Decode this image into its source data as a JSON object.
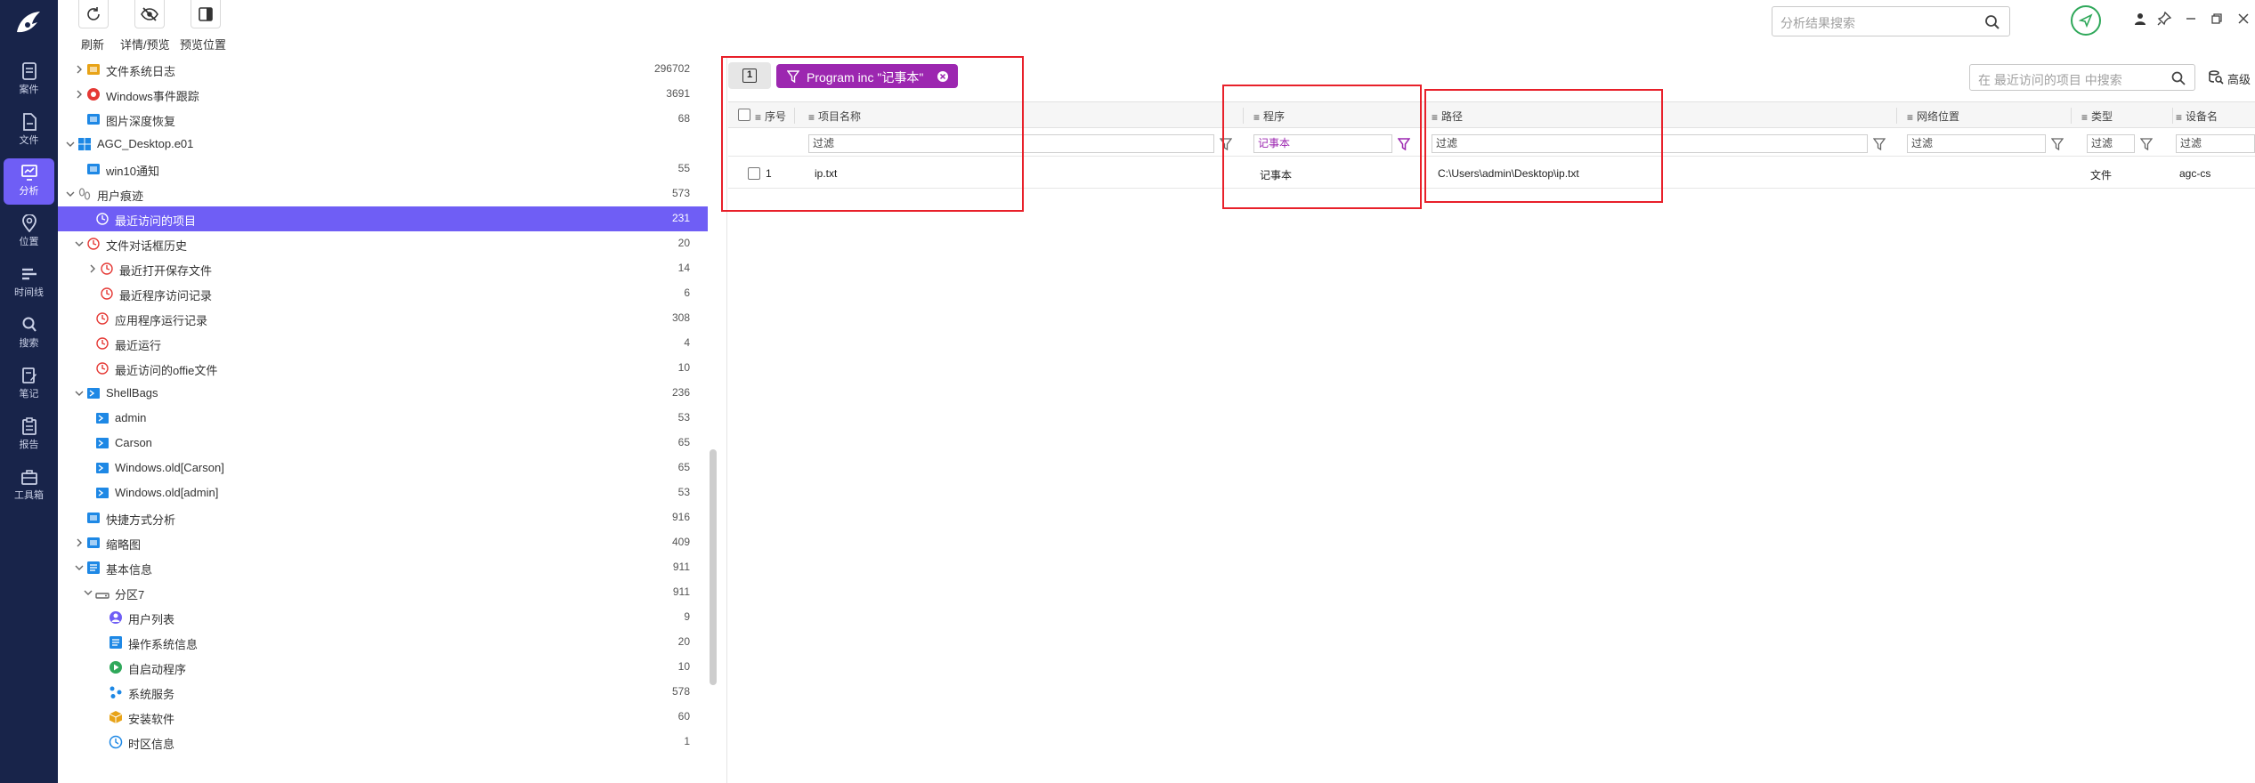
{
  "nav": {
    "items": [
      {
        "label": "案件",
        "icon": "case-icon"
      },
      {
        "label": "文件",
        "icon": "file-icon"
      },
      {
        "label": "分析",
        "icon": "analysis-icon",
        "active": true
      },
      {
        "label": "位置",
        "icon": "location-icon"
      },
      {
        "label": "时间线",
        "icon": "timeline-icon"
      },
      {
        "label": "搜索",
        "icon": "search-icon"
      },
      {
        "label": "笔记",
        "icon": "notes-icon"
      },
      {
        "label": "报告",
        "icon": "report-icon"
      },
      {
        "label": "工具箱",
        "icon": "toolbox-icon"
      }
    ]
  },
  "toolbar": {
    "refresh": "刷新",
    "details": "详情/预览",
    "preview_position": "预览位置"
  },
  "tree": {
    "items": [
      {
        "label": "文件系统日志",
        "count": "296702",
        "icon": "folder-log-icon",
        "color": "#e8a317"
      },
      {
        "label": "Windows事件跟踪",
        "count": "3691",
        "icon": "event-trace-icon",
        "color": "#e53935"
      },
      {
        "label": "图片深度恢复",
        "count": "68",
        "icon": "image-recovery-icon",
        "color": "#1e88e5"
      },
      {
        "label": "AGC_Desktop.e01",
        "count": "",
        "icon": "windows-icon",
        "color": "#1e88e5"
      },
      {
        "label": "win10通知",
        "count": "55",
        "icon": "notification-icon",
        "color": "#1e88e5"
      },
      {
        "label": "用户痕迹",
        "count": "573",
        "icon": "footprint-icon",
        "color": "#888888"
      },
      {
        "label": "最近访问的项目",
        "count": "231",
        "icon": "clock-icon",
        "color": "#e53935",
        "selected": true
      },
      {
        "label": "文件对话框历史",
        "count": "20",
        "icon": "clock-icon",
        "color": "#e53935"
      },
      {
        "label": "最近打开保存文件",
        "count": "14",
        "icon": "clock-icon",
        "color": "#e53935"
      },
      {
        "label": "最近程序访问记录",
        "count": "6",
        "icon": "clock-icon",
        "color": "#e53935"
      },
      {
        "label": "应用程序运行记录",
        "count": "308",
        "icon": "clock-icon",
        "color": "#e53935"
      },
      {
        "label": "最近运行",
        "count": "4",
        "icon": "clock-icon",
        "color": "#e53935"
      },
      {
        "label": "最近访问的offie文件",
        "count": "10",
        "icon": "clock-icon",
        "color": "#e53935"
      },
      {
        "label": "ShellBags",
        "count": "236",
        "icon": "shellbags-icon",
        "color": "#1e88e5"
      },
      {
        "label": "admin",
        "count": "53",
        "icon": "shellbags-icon",
        "color": "#1e88e5"
      },
      {
        "label": "Carson",
        "count": "65",
        "icon": "shellbags-icon",
        "color": "#1e88e5"
      },
      {
        "label": "Windows.old[Carson]",
        "count": "65",
        "icon": "shellbags-icon",
        "color": "#1e88e5"
      },
      {
        "label": "Windows.old[admin]",
        "count": "53",
        "icon": "shellbags-icon",
        "color": "#1e88e5"
      },
      {
        "label": "快捷方式分析",
        "count": "916",
        "icon": "shortcut-icon",
        "color": "#1e88e5"
      },
      {
        "label": "缩略图",
        "count": "409",
        "icon": "thumbnail-icon",
        "color": "#1e88e5"
      },
      {
        "label": "基本信息",
        "count": "911",
        "icon": "basic-info-icon",
        "color": "#1e88e5"
      },
      {
        "label": "分区7",
        "count": "911",
        "icon": "partition-icon",
        "color": "#666666"
      },
      {
        "label": "用户列表",
        "count": "9",
        "icon": "user-list-icon",
        "color": "#6f5ef5"
      },
      {
        "label": "操作系统信息",
        "count": "20",
        "icon": "os-info-icon",
        "color": "#1e88e5"
      },
      {
        "label": "自启动程序",
        "count": "10",
        "icon": "autostart-icon",
        "color": "#2fa85a"
      },
      {
        "label": "系统服务",
        "count": "578",
        "icon": "service-icon",
        "color": "#1e88e5"
      },
      {
        "label": "安装软件",
        "count": "60",
        "icon": "install-icon",
        "color": "#e8a317"
      },
      {
        "label": "时区信息",
        "count": "1",
        "icon": "timezone-icon",
        "color": "#1e88e5"
      }
    ]
  },
  "header": {
    "search_placeholder": "分析结果搜索"
  },
  "results": {
    "count_badge": "1",
    "filter_chip": "Program inc \"记事本\"",
    "search_placeholder": "在 最近访问的项目 中搜索",
    "advanced": "高级"
  },
  "table": {
    "columns": [
      "序号",
      "项目名称",
      "程序",
      "路径",
      "网络位置",
      "类型",
      "设备名"
    ],
    "filter_placeholder": "过滤",
    "program_filter_value": "记事本",
    "rows": [
      {
        "index": "1",
        "name": "ip.txt",
        "program": "记事本",
        "path": "C:\\Users\\admin\\Desktop\\ip.txt",
        "network": "",
        "type": "文件",
        "device": "agc-cs"
      }
    ]
  },
  "colors": {
    "nav_bg": "#18244a",
    "accent": "#6f5ef5",
    "chip": "#9c27b0",
    "highlight_box": "#e8202a"
  }
}
